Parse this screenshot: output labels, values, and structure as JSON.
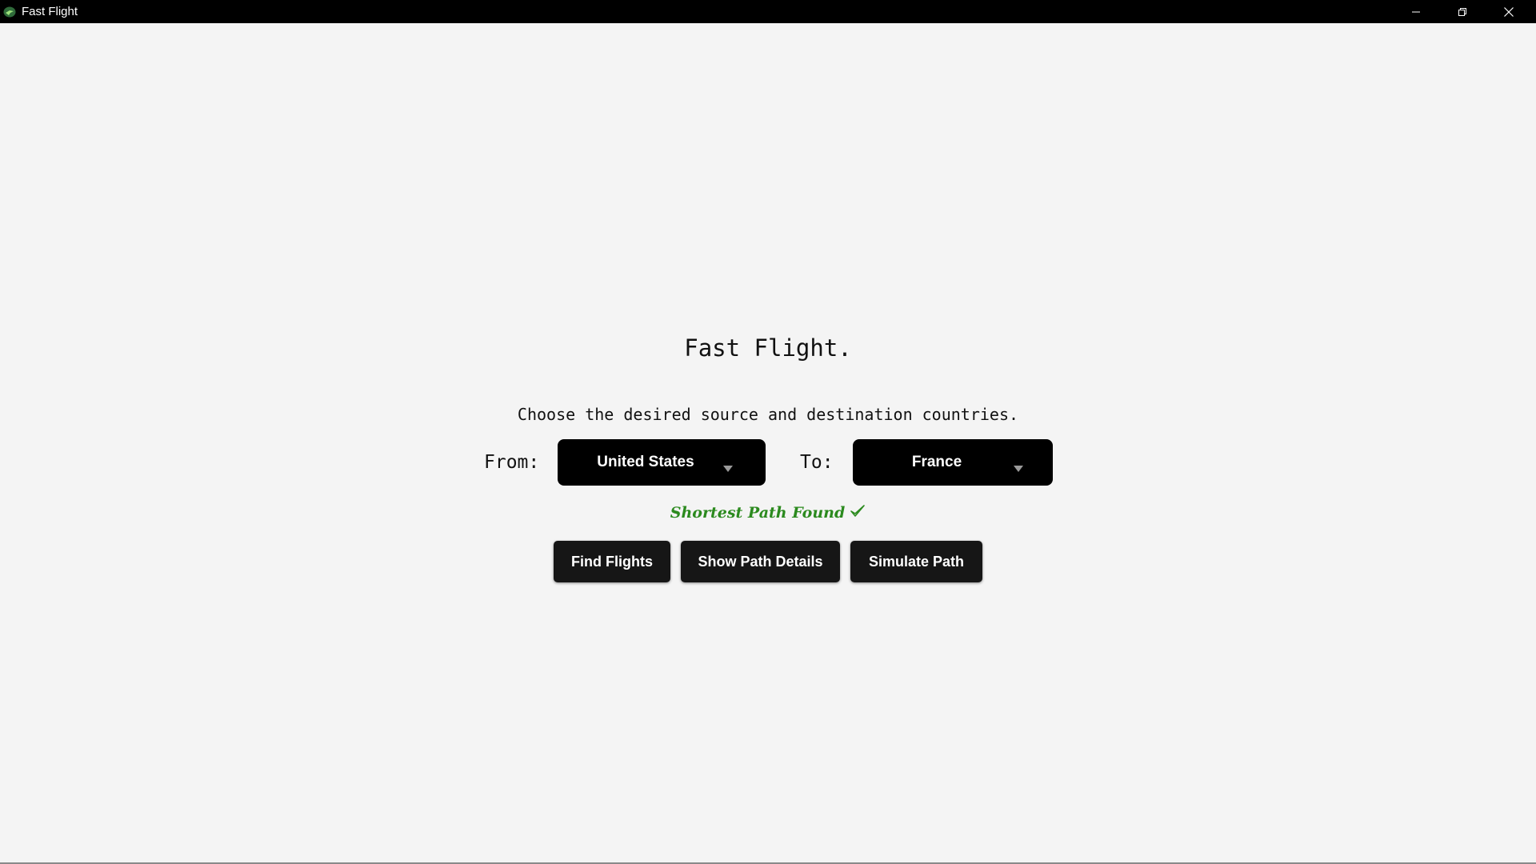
{
  "window": {
    "title": "Fast Flight",
    "icon": "app-logo-icon",
    "controls": [
      "minimize-icon",
      "restore-icon",
      "close-icon"
    ]
  },
  "main": {
    "heading": "Fast Flight.",
    "subheading": "Choose the desired source and destination countries.",
    "from_label": "From:",
    "from_value": "United States",
    "to_label": "To:",
    "to_value": "France",
    "status": "Shortest Path Found",
    "status_color": "#2b8a1e",
    "status_icon": "checkmark-icon"
  },
  "actions": {
    "find_flights": "Find Flights",
    "show_path_details": "Show Path Details",
    "simulate_path": "Simulate Path"
  },
  "colors": {
    "background": "#f4f4f4",
    "titlebar": "#000000",
    "dropdown": "#000000",
    "button": "#161616"
  }
}
